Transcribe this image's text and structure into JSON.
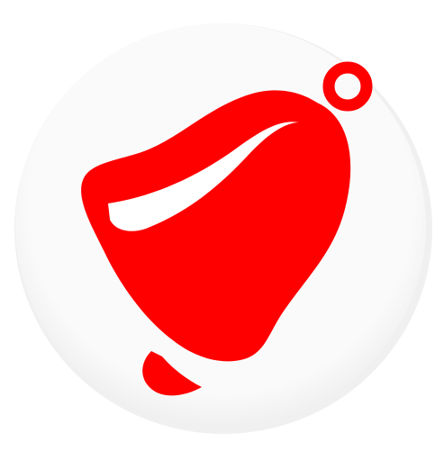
{
  "app_icon": {
    "icon": "bell-icon",
    "colors": {
      "background": "#ffffff",
      "badge": "#f8f8f8",
      "badge_shadow": "#e2e2e2",
      "bell": "#ff0000",
      "highlight": "#ffffff"
    }
  }
}
